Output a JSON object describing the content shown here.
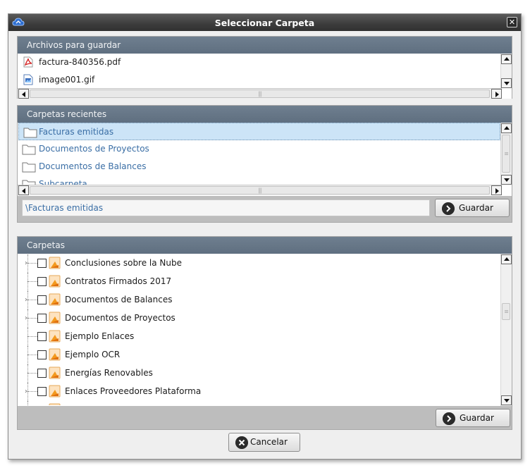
{
  "window": {
    "title": "Seleccionar Carpeta",
    "close_glyph": "✕"
  },
  "files_panel": {
    "header": "Archivos para guardar",
    "files": [
      {
        "name": "factura-840356.pdf",
        "icon": "pdf-file-icon"
      },
      {
        "name": "image001.gif",
        "icon": "image-file-icon"
      }
    ]
  },
  "recent_panel": {
    "header": "Carpetas recientes",
    "folders": [
      {
        "name": "Facturas emitidas",
        "selected": true
      },
      {
        "name": "Documentos de Proyectos",
        "selected": false
      },
      {
        "name": "Documentos de Balances",
        "selected": false
      },
      {
        "name": "Subcarpeta",
        "selected": false
      }
    ],
    "path_value": "\\Facturas emitidas",
    "save_label": "Guardar"
  },
  "folders_panel": {
    "header": "Carpetas",
    "tree": [
      {
        "name": "Conclusiones sobre la Nube",
        "expandable": true
      },
      {
        "name": "Contratos Firmados 2017",
        "expandable": false
      },
      {
        "name": "Documentos de Balances",
        "expandable": true
      },
      {
        "name": "Documentos de Proyectos",
        "expandable": true
      },
      {
        "name": "Ejemplo Enlaces",
        "expandable": false
      },
      {
        "name": "Ejemplo OCR",
        "expandable": false
      },
      {
        "name": "Energías Renovables",
        "expandable": false
      },
      {
        "name": "Enlaces Proveedores Plataforma",
        "expandable": true
      }
    ],
    "save_label": "Guardar"
  },
  "cancel_label": "Cancelar",
  "colors": {
    "titlebar": "#3c3c3c",
    "panel_header": "#667686",
    "selection": "#cce4f7",
    "link_text": "#3a6ea5",
    "folder_orange": "#f39a1e"
  }
}
